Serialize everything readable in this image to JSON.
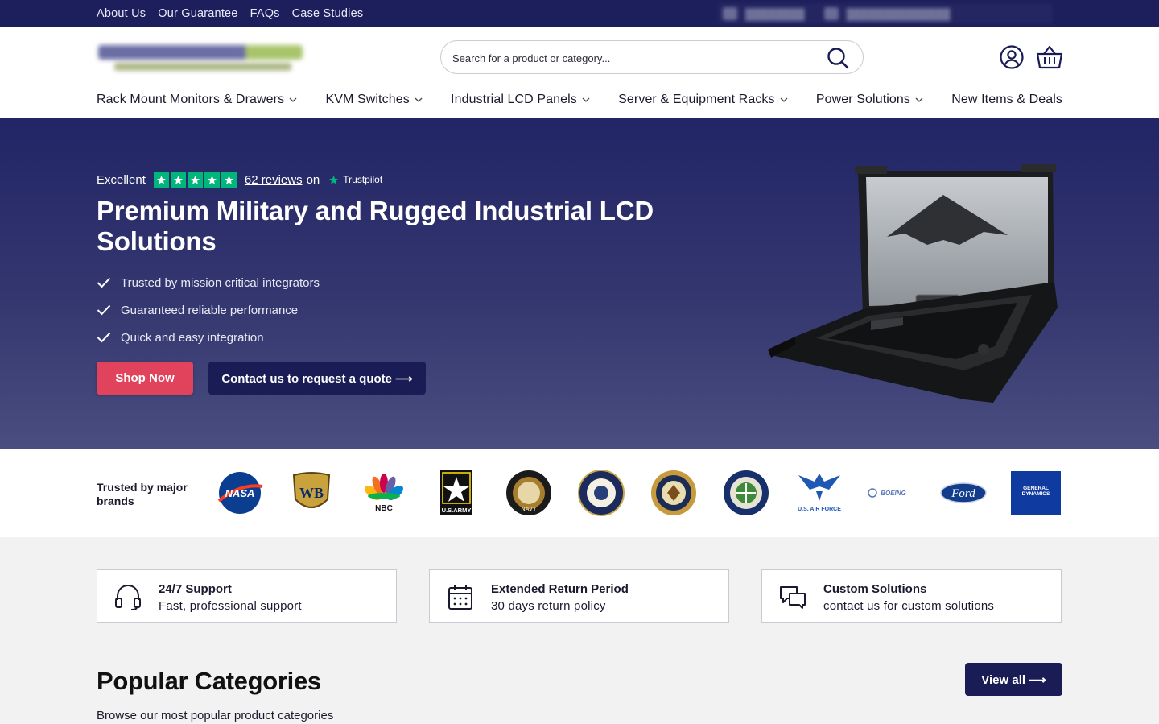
{
  "topbar": {
    "links": [
      "About Us",
      "Our Guarantee",
      "FAQs",
      "Case Studies"
    ],
    "phone_icon": "phone-icon",
    "email_icon": "mail-icon"
  },
  "header": {
    "logo_icon": "company-logo",
    "search": {
      "placeholder": "Search for a product or category...",
      "icon": "search-icon"
    },
    "account_icon": "user-circle-icon",
    "cart_icon": "basket-icon"
  },
  "nav": {
    "items": [
      {
        "label": "Rack Mount Monitors & Drawers",
        "dropdown": true
      },
      {
        "label": "KVM Switches",
        "dropdown": true
      },
      {
        "label": "Industrial LCD Panels",
        "dropdown": true
      },
      {
        "label": "Server & Equipment Racks",
        "dropdown": true
      },
      {
        "label": "Power Solutions",
        "dropdown": true
      },
      {
        "label": "New Items & Deals",
        "dropdown": false
      }
    ]
  },
  "hero": {
    "rating_word": "Excellent",
    "stars": 5,
    "reviews_link": "62 reviews",
    "on_text": "on",
    "trustpilot": "Trustpilot",
    "title": "Premium Military and Rugged Industrial LCD Solutions",
    "bullets": [
      "Trusted by mission critical integrators",
      "Guaranteed reliable performance",
      "Quick and easy integration"
    ],
    "shop_button": "Shop Now",
    "quote_button": "Contact us to request a quote ⟶"
  },
  "brands": {
    "label": "Trusted by major brands",
    "logos": [
      {
        "icon": "nasa-logo",
        "text": "NASA"
      },
      {
        "icon": "warner-bros-logo",
        "text": "WB"
      },
      {
        "icon": "nbc-logo",
        "text": "NBC"
      },
      {
        "icon": "us-army-logo",
        "text": "U.S.ARMY"
      },
      {
        "icon": "us-navy-seal",
        "text": "NAVY"
      },
      {
        "icon": "navy-reserve-seal",
        "text": ""
      },
      {
        "icon": "department-of-justice-seal",
        "text": ""
      },
      {
        "icon": "faa-seal",
        "text": ""
      },
      {
        "icon": "us-air-force-logo",
        "text": "U.S. AIR FORCE"
      },
      {
        "icon": "boeing-logo",
        "text": "BOEING"
      },
      {
        "icon": "ford-logo",
        "text": "Ford"
      },
      {
        "icon": "general-dynamics-logo",
        "text": "GENERAL DYNAMICS"
      }
    ]
  },
  "features": [
    {
      "icon": "headset-icon",
      "title": "24/7 Support",
      "desc": "Fast, professional support"
    },
    {
      "icon": "calendar-icon",
      "title": "Extended Return Period",
      "desc": "30 days return policy"
    },
    {
      "icon": "chat-bubbles-icon",
      "title": "Custom Solutions",
      "desc": "contact us for custom solutions"
    }
  ],
  "popular": {
    "title": "Popular Categories",
    "subtitle": "Browse our most popular product categories",
    "view_all": "View all ⟶"
  }
}
